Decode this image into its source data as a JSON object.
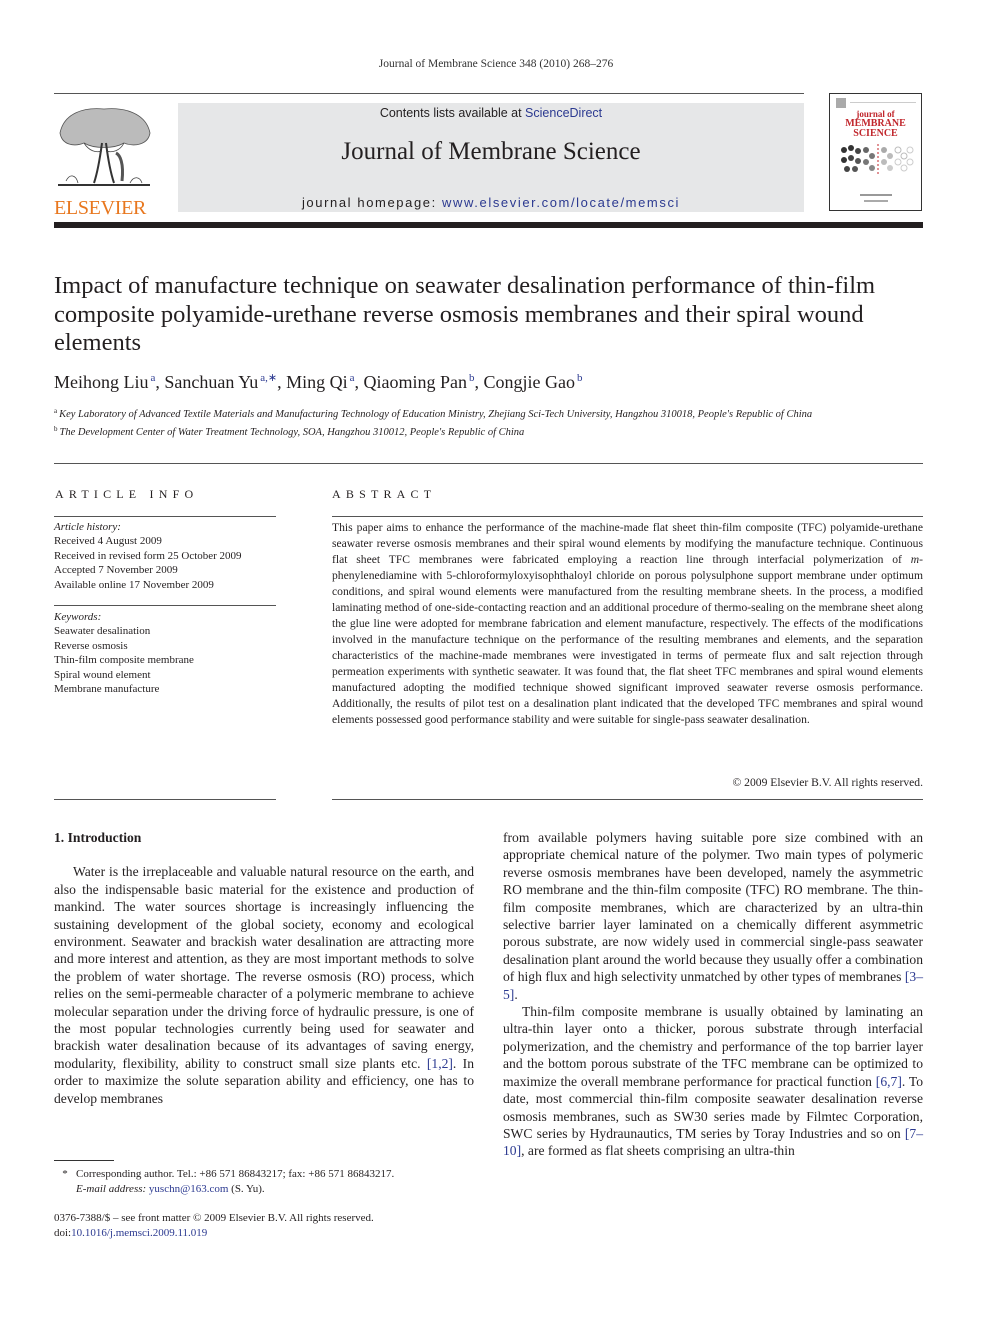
{
  "running_head": "Journal of Membrane Science 348 (2010) 268–276",
  "header": {
    "publisher_logo_text": "ELSEVIER",
    "contents_prefix": "Contents lists available at ",
    "contents_link": "ScienceDirect",
    "journal_name": "Journal of Membrane Science",
    "homepage_prefix": "journal homepage: ",
    "homepage_url": "www.elsevier.com/locate/memsci",
    "cover": {
      "line1": "journal of",
      "line2": "MEMBRANE",
      "line3": "SCIENCE"
    }
  },
  "article": {
    "title": "Impact of manufacture technique on seawater desalination performance of thin-film composite polyamide-urethane reverse osmosis membranes and their spiral wound elements",
    "authors": [
      {
        "name": "Meihong Liu",
        "sup": "a"
      },
      {
        "name": "Sanchuan Yu",
        "sup": "a,∗"
      },
      {
        "name": "Ming Qi",
        "sup": "a"
      },
      {
        "name": "Qiaoming Pan",
        "sup": "b"
      },
      {
        "name": "Congjie Gao",
        "sup": "b"
      }
    ],
    "affiliations": [
      {
        "mark": "a",
        "text": "Key Laboratory of Advanced Textile Materials and Manufacturing Technology of Education Ministry, Zhejiang Sci-Tech University, Hangzhou 310018, People's Republic of China"
      },
      {
        "mark": "b",
        "text": "The Development Center of Water Treatment Technology, SOA, Hangzhou 310012, People's Republic of China"
      }
    ]
  },
  "article_info": {
    "heading": "ARTICLE INFO",
    "history_label": "Article history:",
    "history": [
      "Received 4 August 2009",
      "Received in revised form 25 October 2009",
      "Accepted 7 November 2009",
      "Available online 17 November 2009"
    ],
    "keywords_label": "Keywords:",
    "keywords": [
      "Seawater desalination",
      "Reverse osmosis",
      "Thin-film composite membrane",
      "Spiral wound element",
      "Membrane manufacture"
    ]
  },
  "abstract": {
    "heading": "ABSTRACT",
    "text_part1": "This paper aims to enhance the performance of the machine-made flat sheet thin-film com­posite (TFC) polyamide-urethane seawater reverse osmosis membranes and their spiral wound elements by modifying the manufacture technique. Continuous flat sheet TFC membranes were fab­ricated employing a reaction line through interfacial polymerization of ",
    "text_italic": "m",
    "text_part2": "-phenylenediamine with 5-chloroformyloxyisophthaloyl chloride on porous polysulphone support membrane under optimum conditions, and spiral wound elements were manufactured from the resulting membrane sheets. In the process, a modified laminating method of one-side-contacting reaction and an additional procedure of thermo-sealing on the membrane sheet along the glue line were adopted for membrane fabrication and element manufacture, respectively. The effects of the modifications involved in the manufacture tech­nique on the performance of the resulting membranes and elements, and the separation characteristics of the machine-made membranes were investigated in terms of permeate flux and salt rejection through permeation experiments with synthetic seawater. It was found that, the flat sheet TFC membranes and spiral wound elements manufactured adopting the modified technique showed significant improved sea­water reverse osmosis performance. Additionally, the results of pilot test on a desalination plant indicated that the developed TFC membranes and spiral wound elements possessed good performance stability and were suitable for single-pass seawater desalination.",
    "copyright": "© 2009 Elsevier B.V. All rights reserved."
  },
  "body": {
    "section_heading": "1.  Introduction",
    "left_p1_a": "Water is the irreplaceable and valuable natural resource on the earth, and also the indispensable basic material for the exis­tence and production of mankind. The water sources shortage is increasingly influencing the sustaining development of the global society, economy and ecological environment. Seawater and brack­ish water desalination are attracting more and more interest and attention, as they are most important methods to solve the prob­lem of water shortage. The reverse osmosis (RO) process, which relies on the semi-permeable character of a polymeric membrane to achieve molecular separation under the driving force of hydraulic pressure, is one of the most popular technologies currently being used for seawater and brackish water desalination because of its advantages of saving energy, modularity, flexibility, ability to con­struct small size plants etc. ",
    "left_p1_ref": "[1,2]",
    "left_p1_b": ". In order to maximize the solute separation ability and efficiency, one has to develop membranes",
    "right_p1_a": "from available polymers having suitable pore size combined with an appropriate chemical nature of the polymer. Two main types of polymeric reverse osmosis membranes have been developed, namely the asymmetric RO membrane and the thin-film composite (TFC) RO membrane. The thin-film composite membranes, which are characterized by an ultra-thin selective barrier layer laminated on a chemically different asymmetric porous substrate, are now widely used in commercial single-pass seawater desalination plant around the world because they usually offer a combination of high flux and high selectivity unmatched by other types of membranes ",
    "right_p1_ref": "[3–5]",
    "right_p1_b": ".",
    "right_p2_a": "Thin-film composite membrane is usually obtained by laminat­ing an ultra-thin layer onto a thicker, porous substrate through interfacial polymerization, and the chemistry and performance of the top barrier layer and the bottom porous substrate of the TFC membrane can be optimized to maximize the overall membrane performance for practical function ",
    "right_p2_ref1": "[6,7]",
    "right_p2_b": ". To date, most commer­cial thin-film composite seawater desalination reverse osmosis membranes, such as SW30 series made by Filmtec Corporation, SWC series by Hydraunautics, TM series by Toray Industries and so on ",
    "right_p2_ref2": "[7–10]",
    "right_p2_c": ", are formed as flat sheets comprising an ultra-thin"
  },
  "footnote": {
    "star": "*",
    "corresponding": "Corresponding author. Tel.: +86 571 86843217; fax: +86 571 86843217.",
    "email_label": "E-mail address: ",
    "email": "yuschn@163.com",
    "email_suffix": " (S. Yu)."
  },
  "front_matter": {
    "issn_line": "0376-7388/$ – see front matter © 2009 Elsevier B.V. All rights reserved.",
    "doi_prefix": "doi:",
    "doi": "10.1016/j.memsci.2009.11.019"
  },
  "colors": {
    "link": "#2b3990",
    "elsevier_orange": "#e8771e",
    "banner_gray": "#e6e7e8",
    "cover_red": "#c1272d"
  }
}
